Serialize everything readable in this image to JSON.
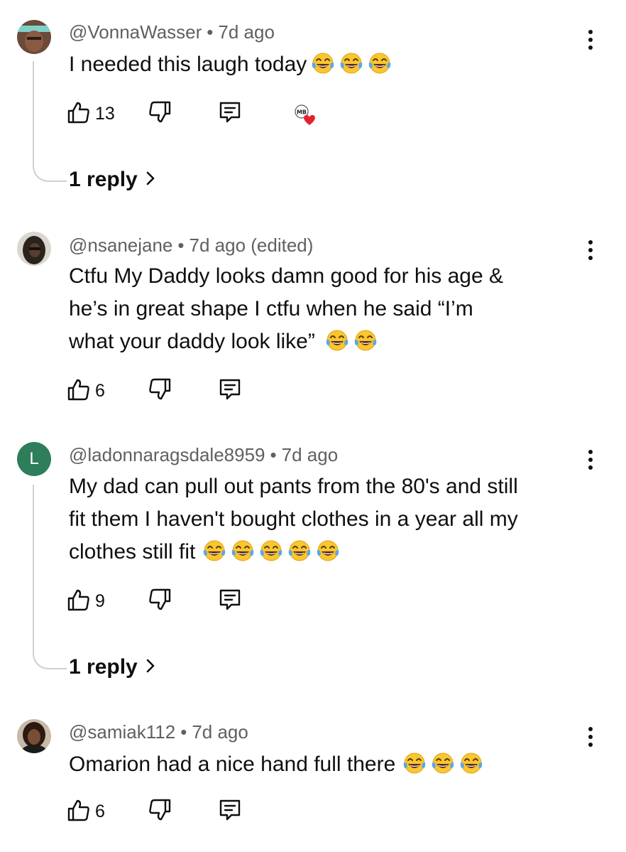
{
  "comments": [
    {
      "author": "@VonnaWasser",
      "separator": "•",
      "time": "7d ago",
      "text": "I needed this laugh today",
      "emoji_count": 3,
      "emoji_icon": "tears-of-joy-emoji",
      "likes": "13",
      "has_creator_heart": true,
      "replies": "1 reply"
    },
    {
      "author": "@nsanejane",
      "separator": "•",
      "time": "7d ago (edited)",
      "text_lines": [
        "Ctfu My Daddy looks damn good for his age &",
        "he’s in great shape I ctfu when he said “I’m",
        "what your daddy look like”"
      ],
      "emoji_count": 2,
      "emoji_icon": "tears-of-joy-emoji",
      "likes": "6"
    },
    {
      "author": "@ladonnaragsdale8959",
      "separator": "•",
      "time": "7d ago",
      "avatar_letter": "L",
      "text_lines": [
        "My dad can pull out pants from the 80's and still",
        "fit them I haven't bought clothes in a year all my",
        "clothes still fit"
      ],
      "emoji_count": 5,
      "emoji_icon": "tears-of-joy-emoji",
      "likes": "9",
      "replies": "1 reply"
    },
    {
      "author": "@samiak112",
      "separator": "•",
      "time": "7d ago",
      "text": "Omarion had a nice hand full there",
      "emoji_count": 3,
      "emoji_icon": "tears-of-joy-emoji",
      "likes": "6"
    }
  ],
  "icons": {
    "like": "thumbs-up-icon",
    "dislike": "thumbs-down-icon",
    "reply": "reply-comment-icon",
    "more": "more-vertical-icon",
    "heart": "creator-heart-icon",
    "chevron": "chevron-right-icon"
  },
  "colors": {
    "meta_text": "#606060",
    "thread_line": "#cfcfcf",
    "avatar_l_bg": "#2e7d5b",
    "heart": "#e5202e"
  }
}
